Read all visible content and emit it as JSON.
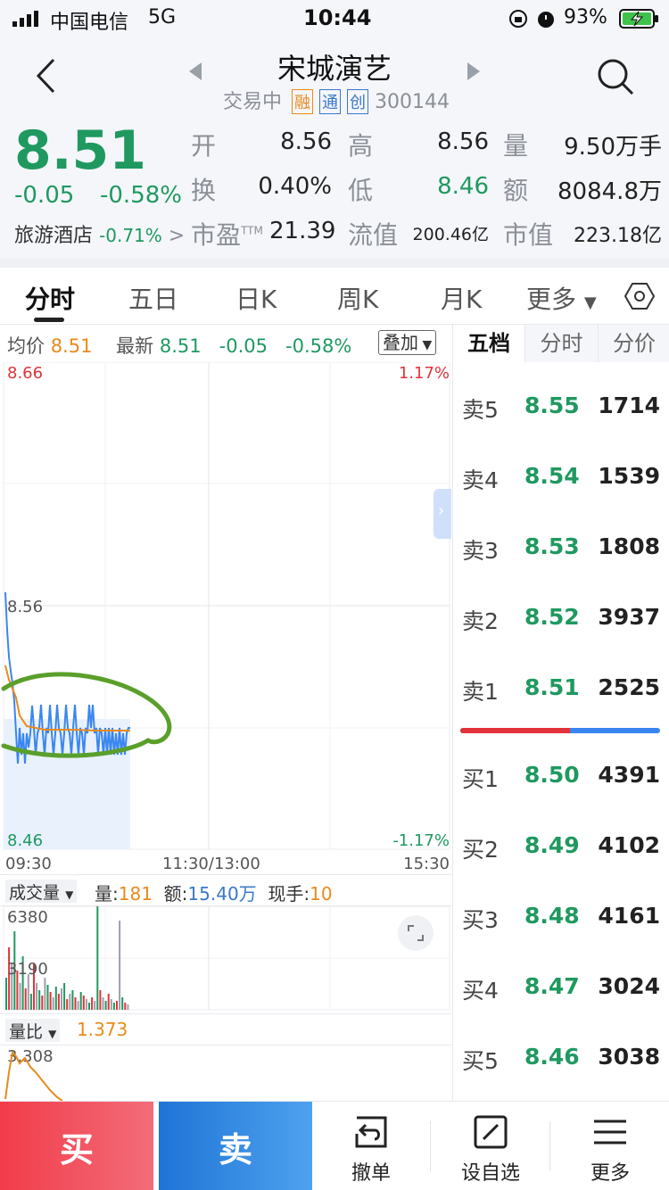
{
  "status_bar": {
    "carrier": "中国电信",
    "network": "5G",
    "time": "10:44",
    "battery": "93%"
  },
  "header": {
    "title": "宋城演艺",
    "trading_status": "交易中",
    "badges": [
      "融",
      "通",
      "创"
    ],
    "code": "300144"
  },
  "quote": {
    "price": "8.51",
    "change": "-0.05",
    "change_pct": "-0.58%",
    "sector_name": "旅游酒店",
    "sector_change": "-0.71%",
    "fields": [
      {
        "label": "开",
        "value": "8.56"
      },
      {
        "label": "高",
        "value": "8.56"
      },
      {
        "label": "量",
        "value": "9.50万手"
      },
      {
        "label": "换",
        "value": "0.40%"
      },
      {
        "label": "低",
        "value": "8.46"
      },
      {
        "label": "额",
        "value": "8084.8万"
      },
      {
        "label": "市盈",
        "sup": "TTM",
        "value": "21.39"
      },
      {
        "label": "流值",
        "value": "200.46亿"
      },
      {
        "label": "市值",
        "value": "223.18亿"
      }
    ]
  },
  "tabs": [
    "分时",
    "五日",
    "日K",
    "周K",
    "月K",
    "更多"
  ],
  "intraday": {
    "avg_label": "均价",
    "avg_value": "8.51",
    "latest_label": "最新",
    "latest_value": "8.51",
    "latest_change": "-0.05",
    "latest_change_pct": "-0.58%",
    "overlay_label": "叠加",
    "y_top": "8.66",
    "y_mid": "8.56",
    "y_bottom": "8.46",
    "pct_top": "1.17%",
    "pct_bottom": "-1.17%",
    "x_start": "09:30",
    "x_mid": "11:30/13:00",
    "x_end": "15:30"
  },
  "volume_panel": {
    "indicator_label": "成交量",
    "vol_label": "量:",
    "vol_value": "181",
    "amount_label": "额:",
    "amount_value": "15.40万",
    "hand_label": "现手:",
    "hand_value": "10",
    "y_top": "6380",
    "y_mid": "3190"
  },
  "ratio_panel": {
    "label": "量比",
    "value": "1.373",
    "y_top": "3.308"
  },
  "order_book": {
    "tabs": [
      "五档",
      "分时",
      "分价"
    ],
    "asks": [
      {
        "label": "卖5",
        "price": "8.55",
        "volume": "1714"
      },
      {
        "label": "卖4",
        "price": "8.54",
        "volume": "1539"
      },
      {
        "label": "卖3",
        "price": "8.53",
        "volume": "1808"
      },
      {
        "label": "卖2",
        "price": "8.52",
        "volume": "3937"
      },
      {
        "label": "卖1",
        "price": "8.51",
        "volume": "2525"
      }
    ],
    "bids": [
      {
        "label": "买1",
        "price": "8.50",
        "volume": "4391"
      },
      {
        "label": "买2",
        "price": "8.49",
        "volume": "4102"
      },
      {
        "label": "买3",
        "price": "8.48",
        "volume": "4161"
      },
      {
        "label": "买4",
        "price": "8.47",
        "volume": "3024"
      },
      {
        "label": "买5",
        "price": "8.46",
        "volume": "3038"
      }
    ],
    "buy_sell_ratio": 0.55
  },
  "bottom_bar": {
    "buy": "买",
    "sell": "卖",
    "cancel": "撤单",
    "watchlist": "设自选",
    "more": "更多"
  },
  "colors": {
    "down": "#1f9960",
    "up": "#e2333a",
    "avg_line": "#e98a1b",
    "price_line": "#3a86f0"
  }
}
